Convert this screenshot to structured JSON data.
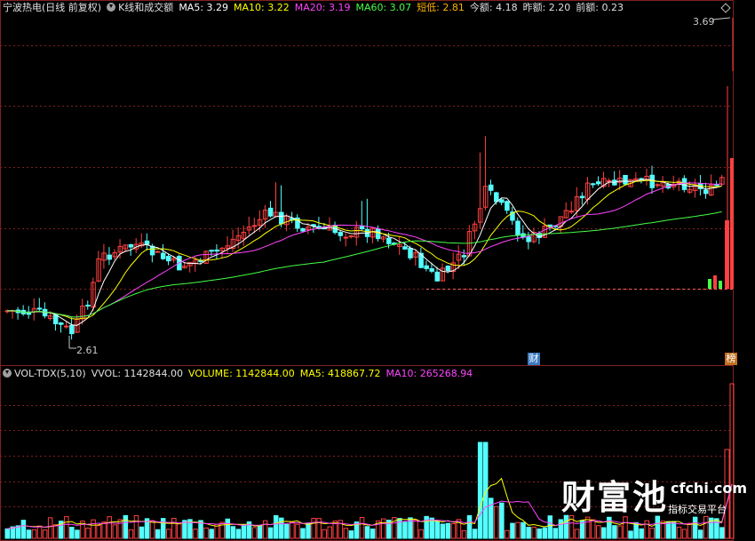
{
  "header": {
    "stock_name": "宁波热电",
    "period": "(日线 前复权)",
    "indicator": "K线和成交额",
    "ma5": "MA5: 3.29",
    "ma10": "MA10: 3.22",
    "ma20": "MA20: 3.19",
    "ma60": "MA60: 3.07",
    "short_low": "短低: 2.81",
    "today_amount": "今额: 4.18",
    "yesterday_amount": "昨额: 2.20",
    "prev_amount": "前额: 0.23"
  },
  "price_chart": {
    "high_label": "3.69",
    "low_label": "2.61",
    "badge_left": "财",
    "badge_right": "榜"
  },
  "volume_header": {
    "name": "VOL-TDX(5,10)",
    "vvol": "VVOL: 1142844.00",
    "volume": "VOLUME: 1142844.00",
    "ma5": "MA5: 418867.72",
    "ma10": "MA10: 265268.94"
  },
  "watermark": {
    "brand": "财富池",
    "url": "cfchi.com",
    "tagline": "指标交易平台"
  },
  "colors": {
    "up": "#ff4040",
    "down": "#54ffff",
    "ma5": "#ffffff",
    "ma10": "#ffff00",
    "ma20": "#ff44ff",
    "ma60": "#44ff44",
    "grid": "#802020"
  }
}
